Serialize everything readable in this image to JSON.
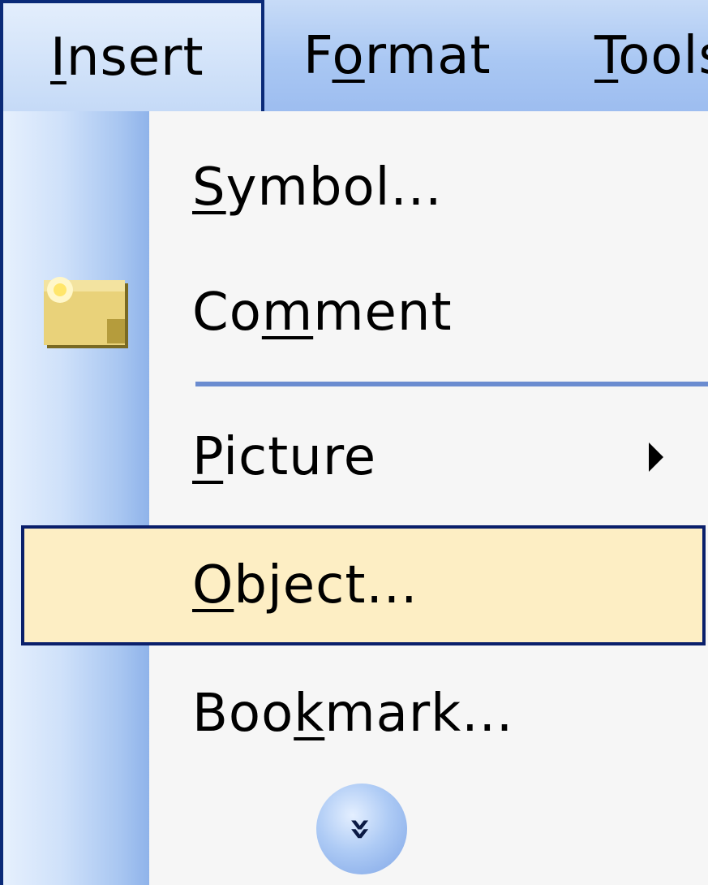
{
  "menubar": {
    "items": [
      {
        "label": "Insert",
        "mnemonic_index": 0
      },
      {
        "label": "Format",
        "mnemonic_index": 1
      },
      {
        "label": "Tools",
        "mnemonic_index": 0
      }
    ]
  },
  "menu": {
    "items": [
      {
        "label": "Symbol...",
        "mnemonic": "S",
        "icon": "none"
      },
      {
        "label": "Comment",
        "mnemonic": "m",
        "icon": "comment-icon"
      },
      {
        "label": "Picture",
        "mnemonic": "P",
        "has_submenu": true
      },
      {
        "label": "Object...",
        "mnemonic": "O",
        "highlighted": true
      },
      {
        "label": "Bookmark...",
        "mnemonic": "k"
      }
    ],
    "expand_glyph": "»"
  },
  "colors": {
    "menubar_bg": "#a9c7f3",
    "active_border": "#0a2a78",
    "highlight_bg": "#fdeec4",
    "separator": "#6b8cd0",
    "menu_bg": "#f6f6f6"
  }
}
